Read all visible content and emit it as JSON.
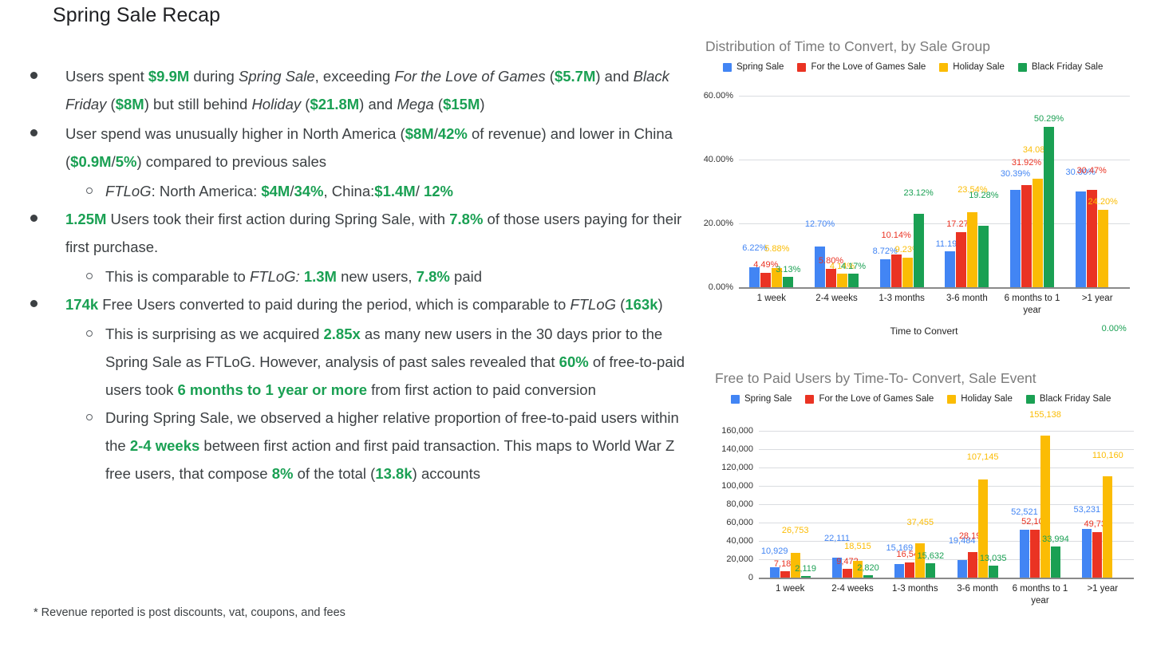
{
  "slide": {
    "title": "Spring Sale Recap",
    "footnote": "* Revenue reported is post discounts, vat, coupons, and fees"
  },
  "bullets": [
    {
      "level": 1,
      "segments": [
        {
          "t": "Users spent ",
          "s": "plain"
        },
        {
          "t": "$9.9M",
          "s": "green"
        },
        {
          "t": " during ",
          "s": "plain"
        },
        {
          "t": "Spring Sale",
          "s": "italic"
        },
        {
          "t": ", exceeding ",
          "s": "plain"
        },
        {
          "t": "For the Love of Games",
          "s": "italic"
        },
        {
          "t": " (",
          "s": "plain"
        },
        {
          "t": "$5.7M",
          "s": "green"
        },
        {
          "t": ") and ",
          "s": "plain"
        },
        {
          "t": "Black Friday",
          "s": "italic"
        },
        {
          "t": " (",
          "s": "plain"
        },
        {
          "t": "$8M",
          "s": "green"
        },
        {
          "t": ") but still behind ",
          "s": "plain"
        },
        {
          "t": "Holiday",
          "s": "italic"
        },
        {
          "t": " (",
          "s": "plain"
        },
        {
          "t": "$21.8M",
          "s": "green"
        },
        {
          "t": ") and ",
          "s": "plain"
        },
        {
          "t": "Mega",
          "s": "italic"
        },
        {
          "t": " (",
          "s": "plain"
        },
        {
          "t": "$15M",
          "s": "green"
        },
        {
          "t": ")",
          "s": "plain"
        }
      ]
    },
    {
      "level": 1,
      "segments": [
        {
          "t": "User spend was unusually higher in North America (",
          "s": "plain"
        },
        {
          "t": "$8M",
          "s": "green"
        },
        {
          "t": "/",
          "s": "plain"
        },
        {
          "t": "42%",
          "s": "green"
        },
        {
          "t": " of revenue) and lower in China (",
          "s": "plain"
        },
        {
          "t": "$0.9M",
          "s": "green"
        },
        {
          "t": "/",
          "s": "plain"
        },
        {
          "t": "5%",
          "s": "green"
        },
        {
          "t": ") compared to previous sales",
          "s": "plain"
        }
      ]
    },
    {
      "level": 2,
      "segments": [
        {
          "t": "FTLoG",
          "s": "italic"
        },
        {
          "t": ": North America: ",
          "s": "plain"
        },
        {
          "t": "$4M",
          "s": "green"
        },
        {
          "t": "/",
          "s": "plain"
        },
        {
          "t": "34%",
          "s": "green"
        },
        {
          "t": ", China:",
          "s": "plain"
        },
        {
          "t": "$1.4M",
          "s": "green"
        },
        {
          "t": "/ ",
          "s": "plain"
        },
        {
          "t": "12%",
          "s": "green"
        }
      ]
    },
    {
      "level": 1,
      "segments": [
        {
          "t": "1.25M",
          "s": "green"
        },
        {
          "t": " Users took their first action during Spring Sale, with ",
          "s": "plain"
        },
        {
          "t": "7.8%",
          "s": "green"
        },
        {
          "t": " of those users paying for their first purchase.",
          "s": "plain"
        }
      ]
    },
    {
      "level": 2,
      "segments": [
        {
          "t": "This is comparable to ",
          "s": "plain"
        },
        {
          "t": "FTLoG:",
          "s": "italic"
        },
        {
          "t": " ",
          "s": "plain"
        },
        {
          "t": "1.3M",
          "s": "green"
        },
        {
          "t": " new users,  ",
          "s": "plain"
        },
        {
          "t": "7.8%",
          "s": "green"
        },
        {
          "t": " paid",
          "s": "plain"
        }
      ]
    },
    {
      "level": 1,
      "segments": [
        {
          "t": "174k",
          "s": "green"
        },
        {
          "t": " Free Users converted to paid during the period, which is comparable to ",
          "s": "plain"
        },
        {
          "t": "FTLoG",
          "s": "italic"
        },
        {
          "t": " (",
          "s": "plain"
        },
        {
          "t": "163k",
          "s": "green"
        },
        {
          "t": ")",
          "s": "plain"
        }
      ]
    },
    {
      "level": 2,
      "segments": [
        {
          "t": "This is surprising as we acquired ",
          "s": "plain"
        },
        {
          "t": "2.85x",
          "s": "green"
        },
        {
          "t": " as many new users in the 30 days prior to the Spring Sale as FTLoG. However, analysis of past sales revealed that ",
          "s": "plain"
        },
        {
          "t": "60%",
          "s": "green"
        },
        {
          "t": " of free-to-paid users took ",
          "s": "plain"
        },
        {
          "t": "6 months to 1 year or more",
          "s": "green"
        },
        {
          "t": " from first action to paid conversion",
          "s": "plain"
        }
      ]
    },
    {
      "level": 2,
      "segments": [
        {
          "t": "During Spring Sale, we observed a higher relative proportion of free-to-paid users within the ",
          "s": "plain"
        },
        {
          "t": "2-4 weeks",
          "s": "green"
        },
        {
          "t": " between first action and first paid transaction. This maps to World War Z free users, that compose ",
          "s": "plain"
        },
        {
          "t": "8%",
          "s": "green"
        },
        {
          "t": " of the total (",
          "s": "plain"
        },
        {
          "t": "13.8k",
          "s": "green"
        },
        {
          "t": ") accounts",
          "s": "plain"
        }
      ]
    }
  ],
  "colors": {
    "spring_sale": "#4285f4",
    "ftlog_sale": "#ea3323",
    "holiday_sale": "#fbbc04",
    "black_friday_sale": "#1aa053",
    "accent_green": "#1aa053",
    "grid": "#dadce0",
    "title_gray": "#7b7b7b"
  },
  "chart_data": [
    {
      "type": "bar",
      "title": "Distribution of Time to Convert, by Sale Group",
      "xlabel": "Time to Convert",
      "ylabel": "",
      "ylim": [
        0,
        60
      ],
      "yticks": [
        "0.00%",
        "20.00%",
        "40.00%",
        "60.00%"
      ],
      "ytick_values": [
        0,
        20,
        40,
        60
      ],
      "grid": true,
      "legend_position": "top",
      "categories": [
        "1 week",
        "2-4 weeks",
        "1-3 months",
        "3-6 month",
        "6 months to 1 year",
        ">1 year"
      ],
      "series": [
        {
          "name": "Spring Sale",
          "color": "#4285f4",
          "values": [
            6.22,
            12.7,
            8.72,
            11.19,
            30.39,
            30.0
          ],
          "labels": [
            "6.22%",
            "12.70%",
            "8.72%",
            "11.19%",
            "30.39%",
            "30.00%"
          ]
        },
        {
          "name": "For the Love of Games Sale",
          "color": "#ea3323",
          "values": [
            4.49,
            5.8,
            10.14,
            17.27,
            31.92,
            30.47
          ],
          "labels": [
            "4.49%",
            "5.80%",
            "10.14%",
            "17.27%",
            "31.92%",
            "30.47%"
          ]
        },
        {
          "name": "Holiday Sale",
          "color": "#fbbc04",
          "values": [
            5.88,
            4.14,
            9.23,
            23.54,
            34.08,
            24.2
          ],
          "labels": [
            "5.88%",
            "4.14%",
            "9.23%",
            "23.54%",
            "34.08%",
            "24.20%"
          ]
        },
        {
          "name": "Black Friday Sale",
          "color": "#1aa053",
          "values": [
            3.13,
            4.17,
            23.12,
            19.28,
            50.29,
            0.0
          ],
          "labels": [
            "3.13%",
            "4.17%",
            "23.12%",
            "19.28%",
            "50.29%",
            "0.00%"
          ]
        }
      ]
    },
    {
      "type": "bar",
      "title": "Free to Paid Users by Time-To- Convert, Sale Event",
      "xlabel": "",
      "ylabel": "",
      "ylim": [
        0,
        160000
      ],
      "yticks": [
        "0",
        "20,000",
        "40,000",
        "60,000",
        "80,000",
        "100,000",
        "120,000",
        "140,000",
        "160,000"
      ],
      "ytick_values": [
        0,
        20000,
        40000,
        60000,
        80000,
        100000,
        120000,
        140000,
        160000
      ],
      "grid": true,
      "legend_position": "top",
      "categories": [
        "1 week",
        "2-4 weeks",
        "1-3 months",
        "3-6 month",
        "6 months to 1 year",
        ">1 year"
      ],
      "series": [
        {
          "name": "Spring Sale",
          "color": "#4285f4",
          "values": [
            10929,
            22111,
            15169,
            19484,
            52521,
            53231
          ],
          "labels": [
            "10,929",
            "22,111",
            "15,169",
            "19,484",
            "52,521",
            "53,231"
          ]
        },
        {
          "name": "For the Love of Games Sale",
          "color": "#ea3323",
          "values": [
            7185,
            9472,
            16541,
            28196,
            52105,
            49739
          ],
          "labels": [
            "7,185",
            "9,472",
            "16,541",
            "28,196",
            "52,105",
            "49,739"
          ]
        },
        {
          "name": "Holiday Sale",
          "color": "#fbbc04",
          "values": [
            26753,
            18515,
            37455,
            107145,
            155138,
            110160
          ],
          "labels": [
            "26,753",
            "18,515",
            "37,455",
            "107,145",
            "155,138",
            "110,160"
          ]
        },
        {
          "name": "Black Friday Sale",
          "color": "#1aa053",
          "values": [
            2119,
            2820,
            15632,
            13035,
            33994,
            0
          ],
          "labels": [
            "2,119",
            "2,820",
            "15,632",
            "13,035",
            "33,994",
            ""
          ]
        }
      ]
    }
  ]
}
